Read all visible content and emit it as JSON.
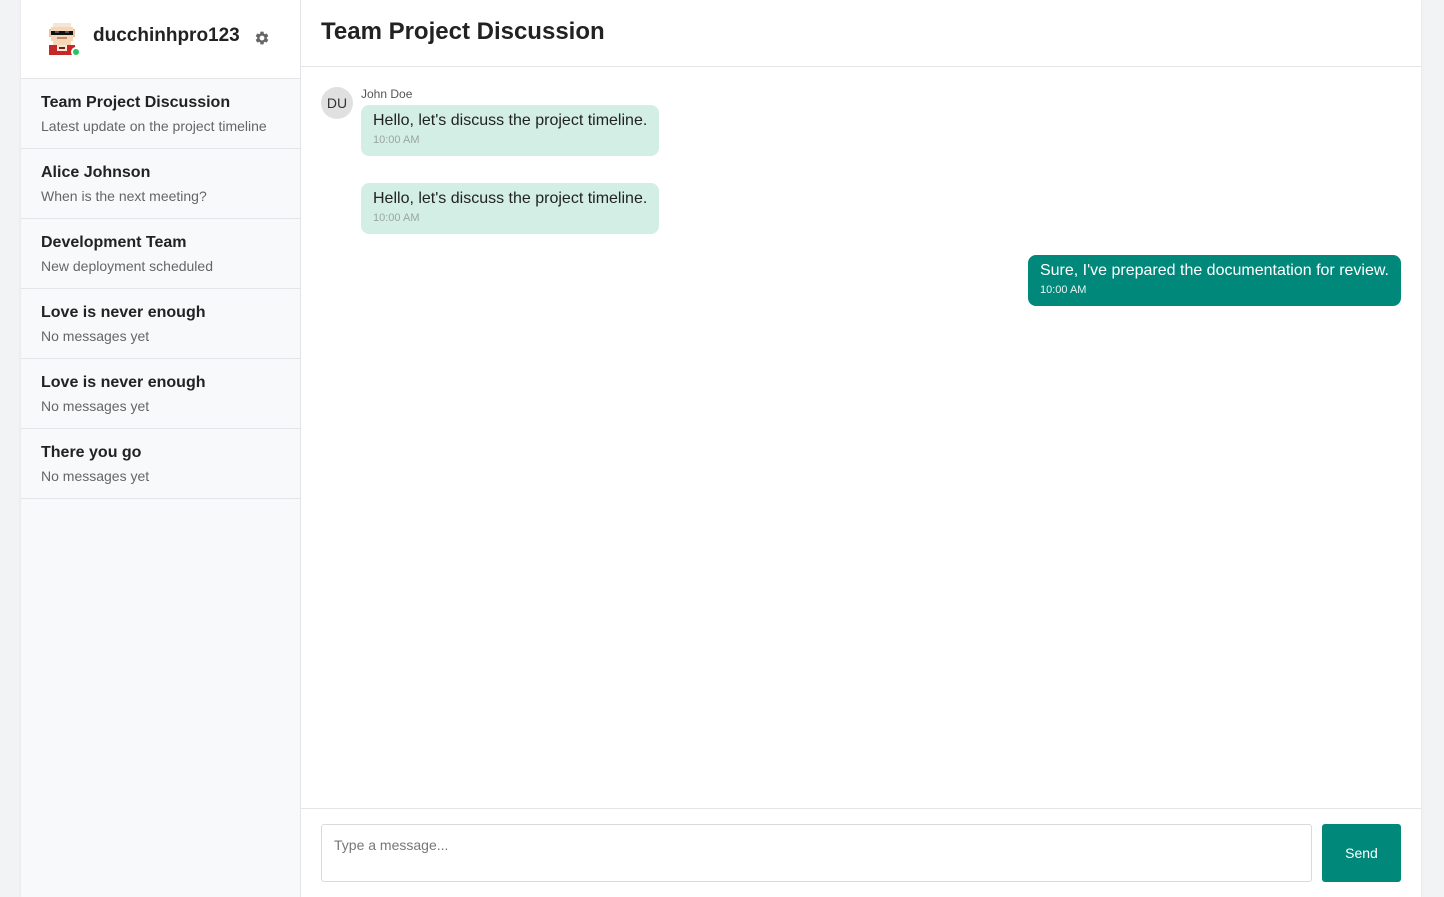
{
  "user": {
    "name": "ducchinhpro123",
    "status": "online",
    "avatar_icon": "pixel-avatar-sunglasses",
    "settings_icon": "gear-icon"
  },
  "conversations": [
    {
      "title": "Team Project Discussion",
      "preview": "Latest update on the project timeline"
    },
    {
      "title": "Alice Johnson",
      "preview": "When is the next meeting?"
    },
    {
      "title": "Development Team",
      "preview": "New deployment scheduled"
    },
    {
      "title": "Love is never enough",
      "preview": "No messages yet"
    },
    {
      "title": "Love is never enough",
      "preview": "No messages yet"
    },
    {
      "title": "There you go",
      "preview": "No messages yet"
    }
  ],
  "chat": {
    "title": "Team Project Discussion",
    "messages": [
      {
        "avatar": "DU",
        "sender": "John Doe",
        "text": "Hello, let's discuss the project timeline.",
        "time": "10:00 AM",
        "direction": "incoming"
      },
      {
        "text": "Hello, let's discuss the project timeline.",
        "time": "10:00 AM",
        "direction": "incoming"
      },
      {
        "text": "Sure, I've prepared the documentation for review.",
        "time": "10:00 AM",
        "direction": "outgoing"
      }
    ]
  },
  "composer": {
    "placeholder": "Type a message...",
    "value": "",
    "send_label": "Send"
  },
  "colors": {
    "accent": "#00897b",
    "incoming_bubble": "#d3efe5",
    "online": "#22c55e",
    "sidebar_bg": "#f8f9fa"
  }
}
